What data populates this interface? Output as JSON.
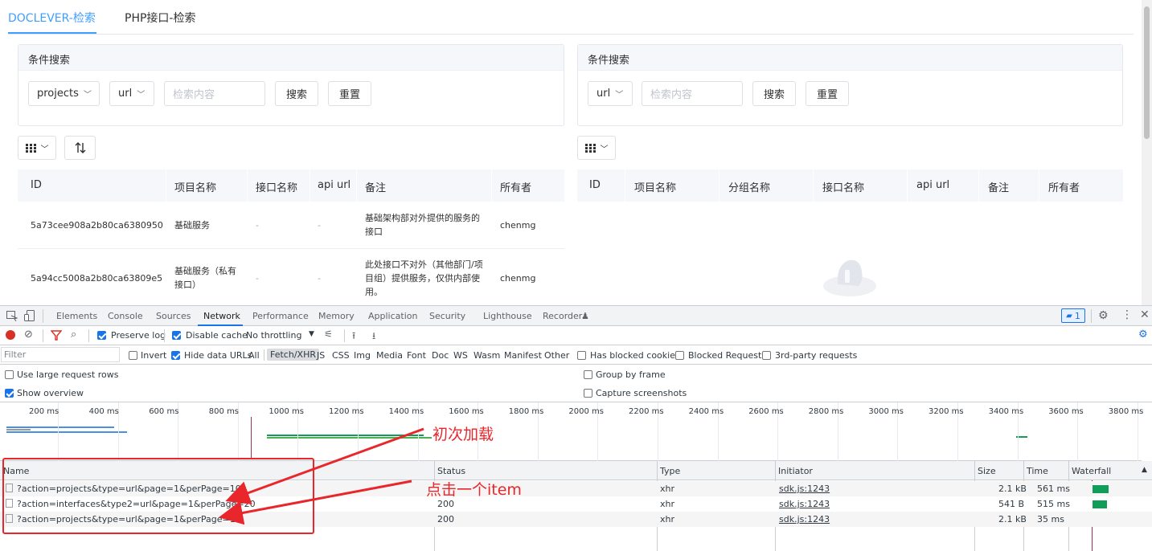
{
  "tabs": [
    {
      "label": "DOCLEVER-检索",
      "active": true
    },
    {
      "label": "PHP接口-检索",
      "active": false
    }
  ],
  "left_panel": {
    "card_title": "条件搜索",
    "project_select": "projects",
    "field_select": "url",
    "search_placeholder": "检索内容",
    "search_button": "搜索",
    "reset_button": "重置",
    "columns": [
      "ID",
      "项目名称",
      "接口名称",
      "api url",
      "备注",
      "所有者"
    ],
    "rows": [
      {
        "id": "5a73cee908a2b80ca6380950",
        "project": "基础服务",
        "interface": "-",
        "api_url": "-",
        "note": "基础架构部对外提供的服务的接口",
        "owner": "chenmg"
      },
      {
        "id": "5a94cc5008a2b80ca63809e5",
        "project": "基础服务（私有接口）",
        "interface": "-",
        "api_url": "-",
        "note": "此处接口不对外（其他部门/项目组）提供服务，仅供内部使用。",
        "owner": "chenmg"
      }
    ]
  },
  "right_panel": {
    "card_title": "条件搜索",
    "field_select": "url",
    "search_placeholder": "检索内容",
    "search_button": "搜索",
    "reset_button": "重置",
    "columns": [
      "ID",
      "项目名称",
      "分组名称",
      "接口名称",
      "api url",
      "备注",
      "所有者"
    ]
  },
  "devtools": {
    "panel_tabs": [
      "Elements",
      "Console",
      "Sources",
      "Network",
      "Performance",
      "Memory",
      "Application",
      "Security",
      "Lighthouse",
      "Recorder"
    ],
    "active_tab": "Network",
    "issues_badge": "1",
    "toolbar": {
      "preserve_log": "Preserve log",
      "disable_cache": "Disable cache",
      "throttling": "No throttling"
    },
    "filter_bar": {
      "placeholder": "Filter",
      "invert": "Invert",
      "hide_data_urls": "Hide data URLs",
      "types": [
        "All",
        "Fetch/XHR",
        "JS",
        "CSS",
        "Img",
        "Media",
        "Font",
        "Doc",
        "WS",
        "Wasm",
        "Manifest",
        "Other"
      ],
      "active_type": "Fetch/XHR",
      "has_blocked_cookies": "Has blocked cookies",
      "blocked_requests": "Blocked Requests",
      "third_party": "3rd-party requests"
    },
    "options": {
      "large_rows": "Use large request rows",
      "show_overview": "Show overview",
      "group_by_frame": "Group by frame",
      "capture_screenshots": "Capture screenshots"
    },
    "timeline_labels": [
      "200 ms",
      "400 ms",
      "600 ms",
      "800 ms",
      "1000 ms",
      "1200 ms",
      "1400 ms",
      "1600 ms",
      "1800 ms",
      "2000 ms",
      "2200 ms",
      "2400 ms",
      "2600 ms",
      "2800 ms",
      "3000 ms",
      "3200 ms",
      "3400 ms",
      "3600 ms",
      "3800 ms"
    ],
    "columns": {
      "name": "Name",
      "status": "Status",
      "type": "Type",
      "initiator": "Initiator",
      "size": "Size",
      "time": "Time",
      "waterfall": "Waterfall"
    },
    "requests": [
      {
        "name": "?action=projects&type=url&page=1&perPage=10",
        "status": "",
        "type": "xhr",
        "initiator": "sdk.js:1243",
        "size": "2.1 kB",
        "time": "561 ms",
        "wf_start_ms": 3340,
        "wf_dur_ms": 561
      },
      {
        "name": "?action=interfaces&type2=url&page=1&perPage=20",
        "status": "200",
        "type": "xhr",
        "initiator": "sdk.js:1243",
        "size": "541 B",
        "time": "515 ms",
        "wf_start_ms": 3340,
        "wf_dur_ms": 515
      },
      {
        "name": "?action=projects&type=url&page=1&perPage=10",
        "status": "200",
        "type": "xhr",
        "initiator": "sdk.js:1243",
        "size": "2.1 kB",
        "time": "35 ms",
        "wf_start_ms": 3340,
        "wf_dur_ms": 35
      }
    ]
  },
  "annotations": {
    "first_load": "初次加载",
    "click_item": "点击一个item"
  },
  "colors": {
    "accent": "#409eff",
    "devtools_blue": "#1a73e8",
    "annotation_red": "#e8262b",
    "waterfall_green": "#0f9d58"
  }
}
